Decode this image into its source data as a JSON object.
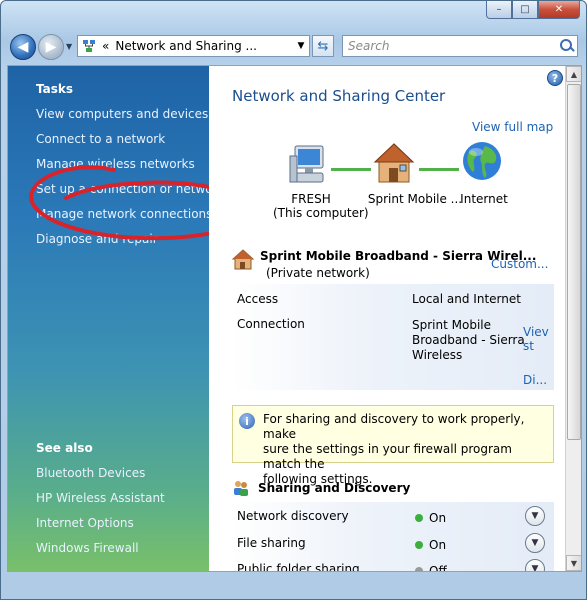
{
  "window": {
    "caption_buttons": {
      "minimize": "–",
      "maximize": "□",
      "close": "✕"
    }
  },
  "address_bar": {
    "chevron": "«",
    "path": "Network and Sharing ...",
    "search_placeholder": "Search"
  },
  "left_pane": {
    "tasks_heading": "Tasks",
    "tasks": [
      "View computers and devices",
      "Connect to a network",
      "Manage wireless networks",
      "Set up a connection or network",
      "Manage network connections",
      "Diagnose and repair"
    ],
    "see_also_heading": "See also",
    "see_also": [
      "Bluetooth Devices",
      "HP Wireless Assistant",
      "Internet Options",
      "Windows Firewall"
    ],
    "annotation_color": "#d8232a"
  },
  "main": {
    "help": "?",
    "title": "Network and Sharing Center",
    "view_full_map": "View full map",
    "network_map": {
      "computer_name": "FRESH",
      "computer_sub": "(This computer)",
      "network_name": "Sprint Mobile ...",
      "internet": "Internet"
    },
    "connection": {
      "name": "Sprint Mobile Broadband - Sierra Wirel...",
      "type": "(Private network)",
      "customize": "Custom...",
      "access_label": "Access",
      "access_value": "Local and Internet",
      "connection_label": "Connection",
      "connection_value_1": "Sprint Mobile",
      "connection_value_2": "Broadband - Sierra",
      "connection_value_3": "Wireless",
      "view_status_1": "Viev",
      "view_status_2": "st",
      "disconnect": "Di..."
    },
    "info_bar": {
      "text_1": "For sharing and discovery to work properly, make",
      "text_2": "sure the settings in your firewall program match the",
      "text_3": "following settings."
    },
    "sharing": {
      "heading": "Sharing and Discovery",
      "rows": [
        {
          "label": "Network discovery",
          "state": "On",
          "color": "#3cae3c"
        },
        {
          "label": "File sharing",
          "state": "On",
          "color": "#3cae3c"
        },
        {
          "label": "Public folder sharing",
          "state": "Off",
          "color": "#9a9a9a"
        }
      ]
    }
  }
}
